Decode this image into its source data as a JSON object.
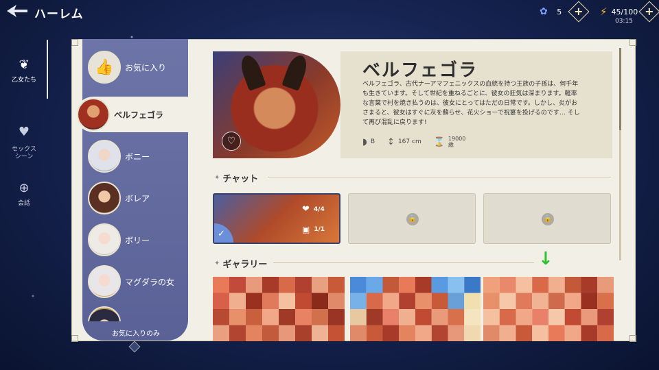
{
  "header": {
    "title": "ハーレム",
    "gems": "5",
    "energy": "45/100",
    "timer": "03:15"
  },
  "nav": {
    "items": [
      {
        "label": "乙女たち",
        "icon": "flower-icon",
        "active": true
      },
      {
        "label": "セックス\nシーン",
        "icon": "scene-icon",
        "active": false
      },
      {
        "label": "会話",
        "icon": "compass-icon",
        "active": false
      }
    ]
  },
  "characters": {
    "favorites": "お気に入り",
    "selected": "ベルフェゴラ",
    "list": [
      "ボニー",
      "ボレア",
      "ボリー",
      "マグダラの女"
    ],
    "filter": "お気に入りのみ"
  },
  "detail": {
    "name": "ベルフェゴラ",
    "description": "ベルフェゴラ、古代ナーアマフェニックスの血統を持つ王族の子孫は、何千年も生きています。そして世紀を重ねるごとに、彼女の狂気は深まります。軽率な言葉で村を焼き払うのは、彼女にとってはただの日常です。しかし、炎がおさまると、彼女はすぐに灰を蘇らせ、花火ショーで祝宴を投げるのです… そして再び混乱に戻ります!",
    "cup": "B",
    "height": "167 cm",
    "age_value": "19000",
    "age_unit": "歳"
  },
  "chat": {
    "title": "チャット",
    "hearts": "4/4",
    "images": "1/1"
  },
  "gallery": {
    "title": "ギャラリー"
  },
  "colors": {
    "panel": "#f2efe6",
    "list_bg": "#6d75a8",
    "accent_green": "#2fc22f"
  }
}
